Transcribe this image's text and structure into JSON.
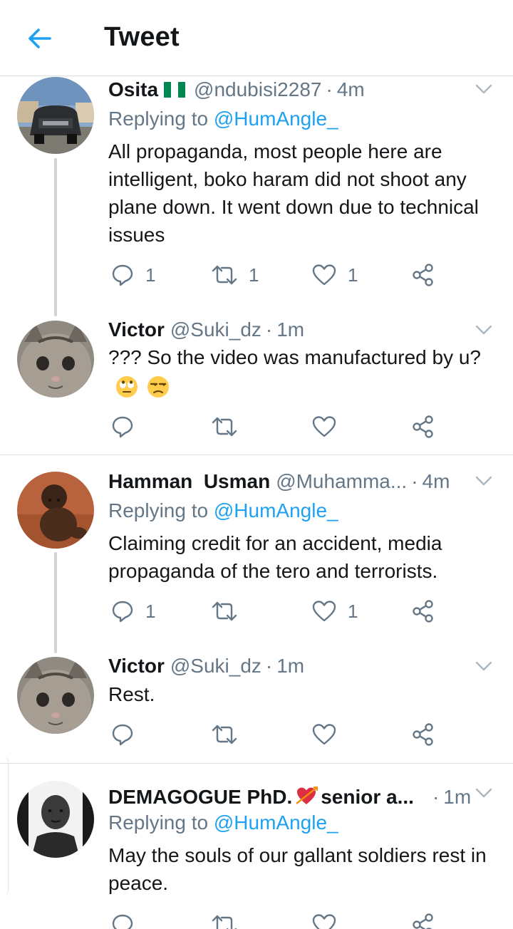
{
  "header": {
    "title": "Tweet"
  },
  "tweets": [
    {
      "name": "Osita",
      "handle": "@ndubisi2287",
      "time": "4m",
      "replying_prefix": "Replying to",
      "replying_to": "@HumAngle_",
      "text": "All propaganda, most people here are intelligent, boko haram did not shoot any plane down. It went down due to technical issues",
      "reply_count": "1",
      "retweet_count": "1",
      "like_count": "1"
    },
    {
      "name": "Victor",
      "handle": "@Suki_dz",
      "time": "1m",
      "text": "??? So the video was manufactured by u?",
      "reply_count": "",
      "retweet_count": "",
      "like_count": ""
    },
    {
      "name": "Hamman  Usman",
      "handle": "@Muhamma...",
      "time": "4m",
      "replying_prefix": "Replying to",
      "replying_to": "@HumAngle_",
      "text": "Claiming credit for an accident, media propaganda of the tero and terrorists.",
      "reply_count": "1",
      "retweet_count": "",
      "like_count": "1"
    },
    {
      "name": "Victor",
      "handle": "@Suki_dz",
      "time": "1m",
      "text": "Rest.",
      "reply_count": "",
      "retweet_count": "",
      "like_count": ""
    },
    {
      "name": "DEMAGOGUE PhD.",
      "name_suffix": "senior a...",
      "handle": "",
      "time": "1m",
      "replying_prefix": "Replying to",
      "replying_to": "@HumAngle_",
      "text": "May the souls of our gallant soldiers rest in peace.",
      "reply_count": "",
      "retweet_count": "",
      "like_count": ""
    }
  ],
  "colors": {
    "accent": "#1da1f2",
    "secondary_text": "#657786",
    "divider": "#dcdfe2",
    "flag_green": "#008751"
  },
  "icons": [
    "back-arrow-icon",
    "chevron-down-icon",
    "reply-icon",
    "retweet-icon",
    "like-icon",
    "share-icon",
    "nigeria-flag-icon",
    "heart-arrow-icon",
    "eye-roll-emoji-icon",
    "unamused-emoji-icon"
  ]
}
